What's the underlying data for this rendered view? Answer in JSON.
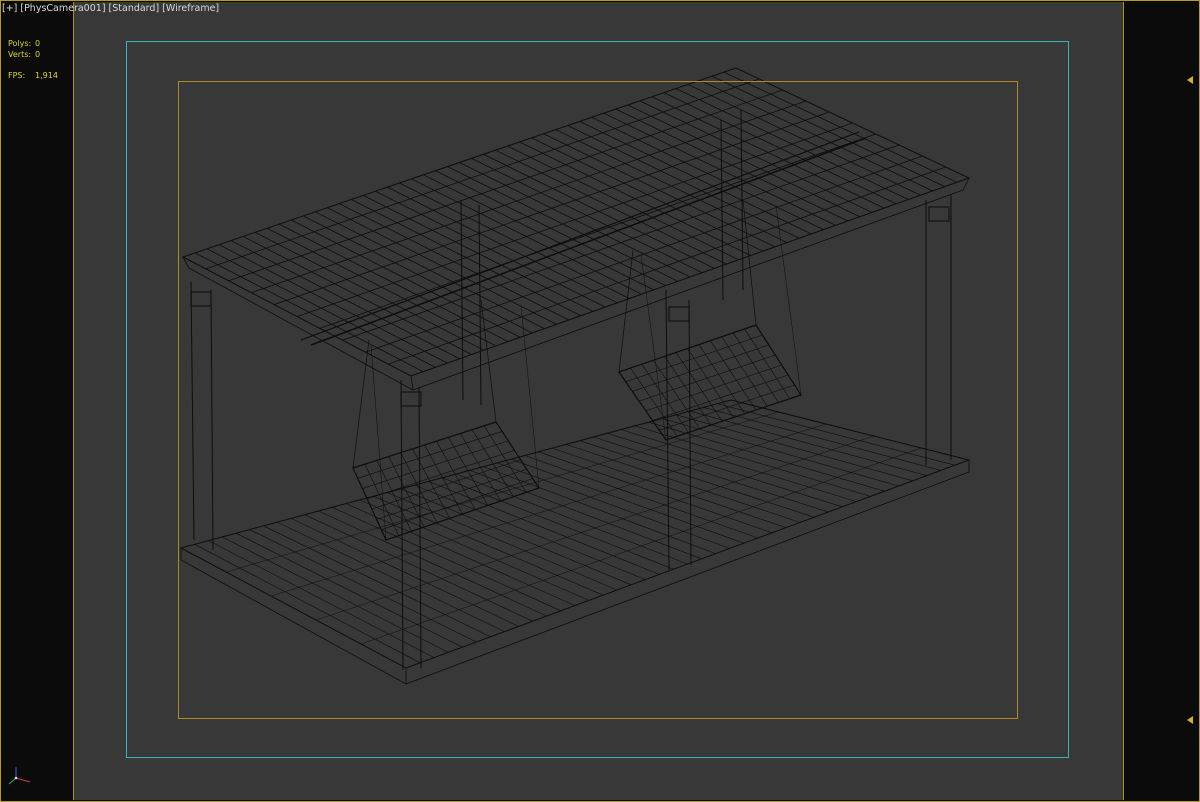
{
  "viewport": {
    "label_plus": "[+]",
    "label_camera": "[PhysCamera001]",
    "label_shading_standard": "[Standard]",
    "label_shading_mode": "[Wireframe]"
  },
  "stats": {
    "polys_label": "Polys:",
    "polys_value": "0",
    "verts_label": "Verts:",
    "verts_value": "0",
    "fps_label": "FPS:",
    "fps_value": "1,914"
  },
  "colors": {
    "background": "#383838",
    "frame_border": "#b59a2a",
    "safe_frame_cyan": "#3ab3c0",
    "safe_frame_gold": "#b08b24",
    "wireframe": "#0d0d0d",
    "stats_text": "#e0d24a"
  },
  "icons": {
    "axis": "axis-tripod-icon",
    "arrow": "viewport-edge-arrow-icon"
  }
}
